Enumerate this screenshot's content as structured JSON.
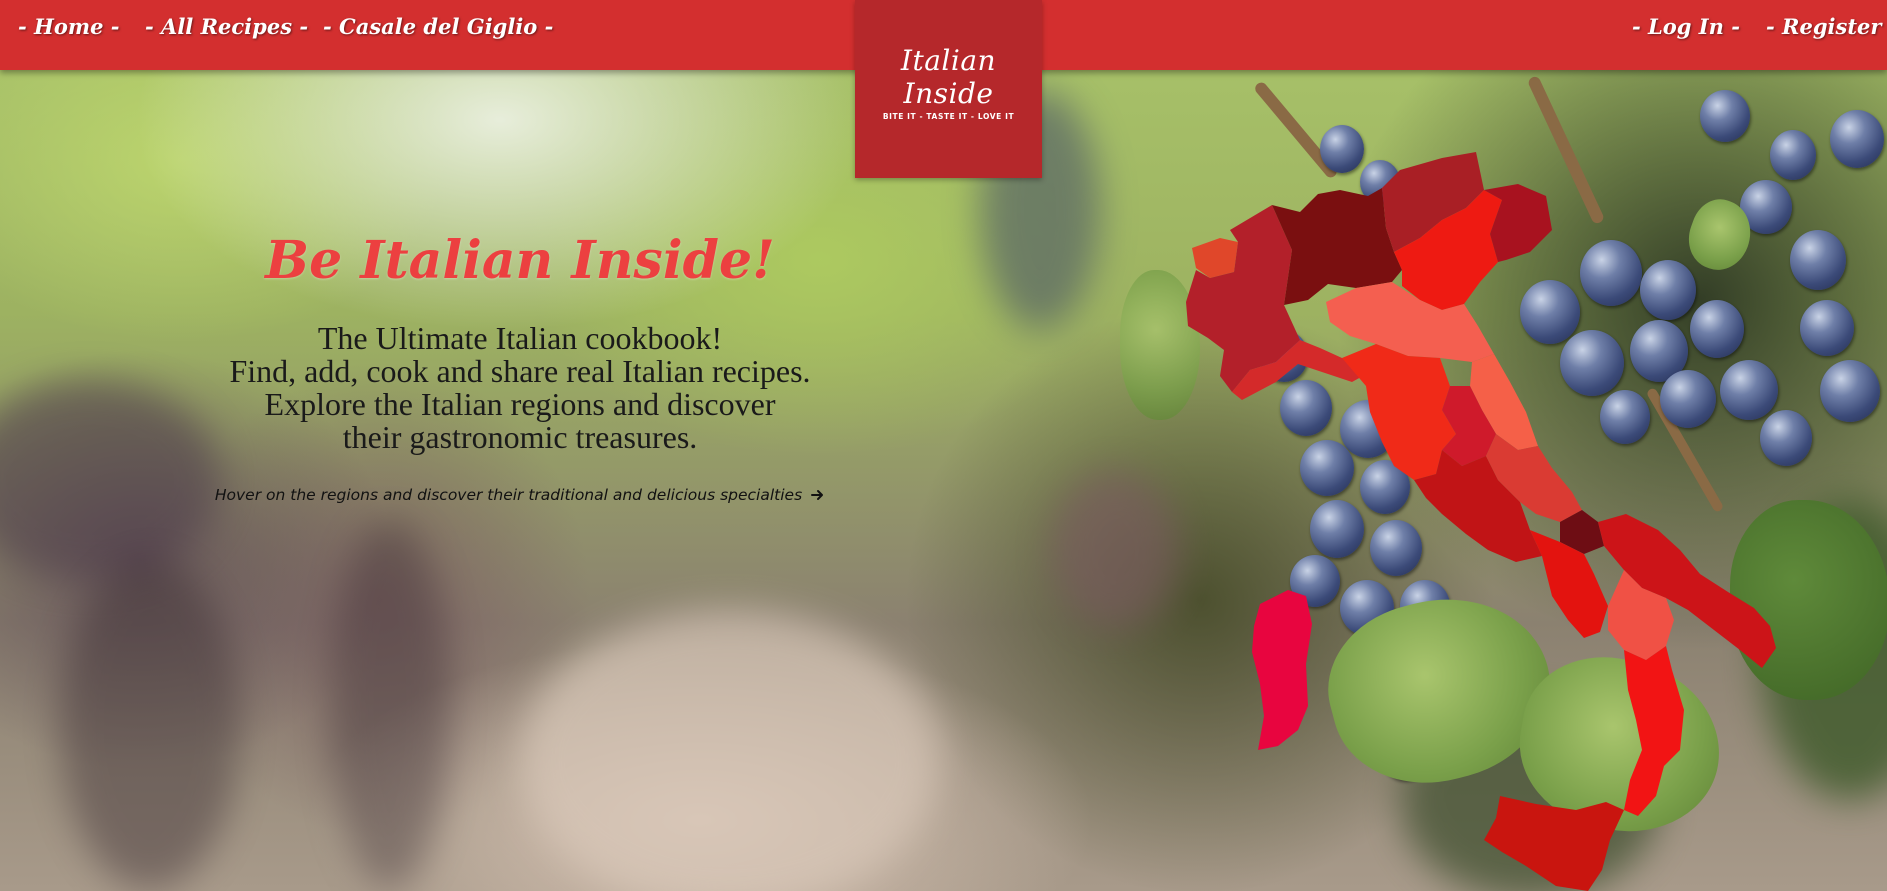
{
  "nav": {
    "home": "- Home -",
    "all_recipes": "- All Recipes -",
    "casale": "- Casale del Giglio -",
    "login": "- Log In -",
    "register": "- Register -"
  },
  "logo": {
    "title": "Italian Inside",
    "tagline": "BITE IT - TASTE IT - LOVE IT"
  },
  "hero": {
    "title": "Be Italian Inside!",
    "lines": [
      "The Ultimate Italian cookbook!",
      "Find, add, cook and share real Italian recipes.",
      "Explore the Italian regions and discover",
      "their gastronomic treasures."
    ],
    "hint": "Hover on the regions and discover their traditional and delicious specialties",
    "hint_icon": "arrow-right-icon"
  },
  "colors": {
    "nav_bg": "#d32f2f",
    "logo_bg": "#b5282b",
    "title": "#ec4040"
  }
}
